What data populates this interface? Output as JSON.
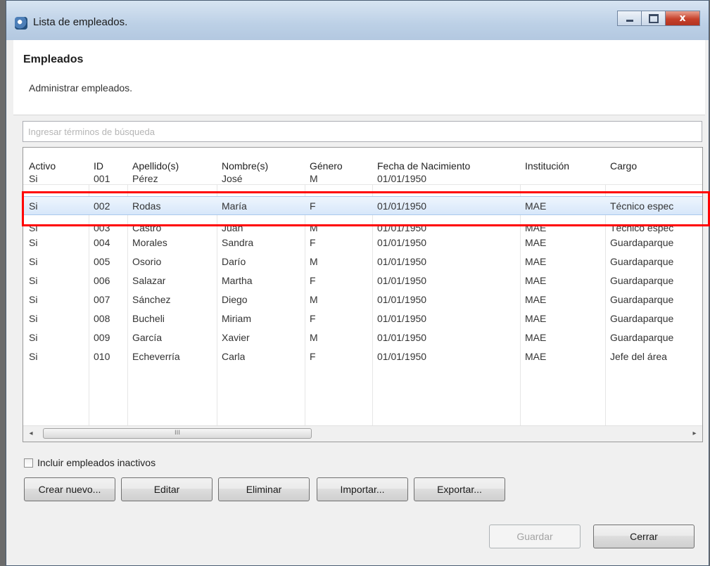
{
  "window": {
    "title": "Lista de empleados.",
    "close_glyph": "x"
  },
  "header": {
    "title": "Empleados",
    "subtitle": "Administrar empleados."
  },
  "search": {
    "placeholder": "Ingresar términos de búsqueda"
  },
  "table": {
    "columns": [
      "Activo",
      "ID",
      "Apellido(s)",
      "Nombre(s)",
      "Género",
      "Fecha de Nacimiento",
      "Institución",
      "Cargo"
    ],
    "rows": [
      [
        "Si",
        "001",
        "Pérez",
        "José",
        "M",
        "01/01/1950",
        "",
        ""
      ],
      [
        "Si",
        "002",
        "Rodas",
        "María",
        "F",
        "01/01/1950",
        "MAE",
        "Técnico espec"
      ],
      [
        "Si",
        "003",
        "Castro",
        "Juan",
        "M",
        "01/01/1950",
        "MAE",
        "Técnico espec"
      ],
      [
        "Si",
        "004",
        "Morales",
        "Sandra",
        "F",
        "01/01/1950",
        "MAE",
        "Guardaparque"
      ],
      [
        "Si",
        "005",
        "Osorio",
        "Darío",
        "M",
        "01/01/1950",
        "MAE",
        "Guardaparque"
      ],
      [
        "Si",
        "006",
        "Salazar",
        "Martha",
        "F",
        "01/01/1950",
        "MAE",
        "Guardaparque"
      ],
      [
        "Si",
        "007",
        "Sánchez",
        "Diego",
        "M",
        "01/01/1950",
        "MAE",
        "Guardaparque"
      ],
      [
        "Si",
        "008",
        "Bucheli",
        "Miriam",
        "F",
        "01/01/1950",
        "MAE",
        "Guardaparque"
      ],
      [
        "Si",
        "009",
        "García",
        "Xavier",
        "M",
        "01/01/1950",
        "MAE",
        "Guardaparque"
      ],
      [
        "Si",
        "010",
        "Echeverría",
        "Carla",
        "F",
        "01/01/1950",
        "MAE",
        "Jefe del área"
      ]
    ],
    "selected_row": 1,
    "scroll_grip": "III",
    "scroll_left": "◂",
    "scroll_right": "▸"
  },
  "include_inactive": {
    "label": "Incluir empleados inactivos",
    "checked": false
  },
  "actions": {
    "create": "Crear nuevo...",
    "edit": "Editar",
    "delete": "Eliminar",
    "import": "Importar...",
    "export": "Exportar..."
  },
  "footer": {
    "save": "Guardar",
    "close": "Cerrar"
  },
  "colors": {
    "highlight": "#ff0000",
    "selected_row": "#d7e7fa"
  }
}
